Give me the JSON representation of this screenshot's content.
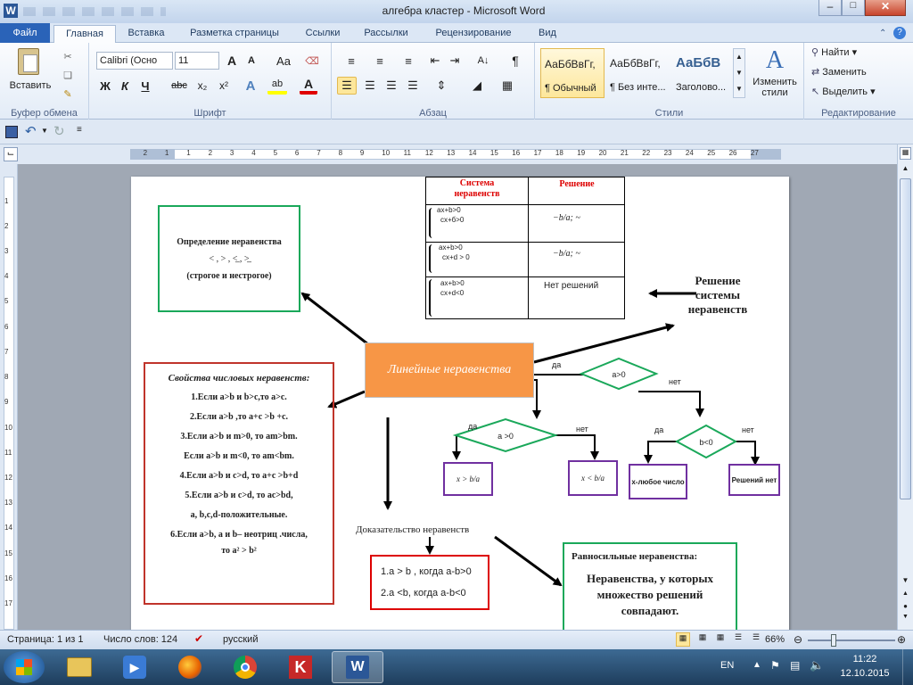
{
  "window": {
    "title": "алгебра кластер  -  Microsoft Word",
    "icon": "W"
  },
  "ribbon_tabs": [
    "Файл",
    "Главная",
    "Вставка",
    "Разметка страницы",
    "Ссылки",
    "Рассылки",
    "Рецензирование",
    "Вид"
  ],
  "clipboard": {
    "paste_label": "Вставить",
    "group_label": "Буфер обмена"
  },
  "font": {
    "name": "Calibri (Осно",
    "size": "11",
    "group_label": "Шрифт",
    "bold": "Ж",
    "italic": "К",
    "underline": "Ч",
    "strike": "abc",
    "sub": "x₂",
    "sup": "x²",
    "grow": "A",
    "shrink": "A",
    "case": "Aa"
  },
  "paragraph": {
    "group_label": "Абзац"
  },
  "styles": {
    "group_label": "Стили",
    "items": [
      {
        "preview": "АаБбВвГг,",
        "name": "¶ Обычный"
      },
      {
        "preview": "АаБбВвГг,",
        "name": "¶ Без инте..."
      },
      {
        "preview": "АаБбВ",
        "name": "Заголово..."
      }
    ],
    "change_label": "Изменить стили"
  },
  "editing": {
    "group_label": "Редактирование",
    "find": "Найти",
    "replace": "Заменить",
    "select": "Выделить"
  },
  "ruler_marks": [
    "2",
    "1",
    "1",
    "2",
    "3",
    "4",
    "5",
    "6",
    "7",
    "8",
    "9",
    "10",
    "11",
    "12",
    "13",
    "14",
    "15",
    "16",
    "17",
    "18",
    "19",
    "20",
    "21",
    "22",
    "23",
    "24",
    "25",
    "26",
    "27"
  ],
  "vruler_marks": [
    "1",
    "2",
    "3",
    "4",
    "5",
    "6",
    "7",
    "8",
    "9",
    "10",
    "11",
    "12",
    "13",
    "14",
    "15",
    "16",
    "17"
  ],
  "document": {
    "table": {
      "headers": [
        "Система неравенств",
        "Решение"
      ],
      "rows": [
        {
          "lines": [
            "ax+b>0",
            "cx+б>0"
          ],
          "solution": "−b/a;  ~"
        },
        {
          "lines": [
            "ax+b>0",
            "cx+d > 0"
          ],
          "solution": "−b/a;  ~"
        },
        {
          "lines": [
            "ax+b>0",
            "cx+d<0"
          ],
          "solution": "Нет решений"
        }
      ]
    },
    "definition": {
      "title": "Определение неравенства",
      "signs": "< , > ,  <̲ ,  >̲",
      "subtitle": "(строгое и нестрогое)"
    },
    "center": "Линейные неравенства",
    "system_solution": "Решение системы неравенств",
    "properties": {
      "title": "Свойства числовых неравенств:",
      "items": [
        "1.Если a>b и b>c,то a>c.",
        "2.Если  a>b ,то  a+c >b +c.",
        "3.Если a>b и m>0, то am>bm.",
        "Если  a>b и m<0, то am<bm.",
        "4.Если a>b и c>d, то a+c >b+d",
        "5.Если a>b и c>d, то ac>bd,",
        "a, b,c,d-положительные.",
        "6.Если a>b, a и b– неотриц .числа,",
        "то  a² > b²"
      ]
    },
    "flow": {
      "cond_a0": "a>0",
      "cond_a_gt0": "a >0",
      "cond_b0": "b<0",
      "yes": "да",
      "no": "нет",
      "x_gt": "x > b/a",
      "x_lt": "x < b/a",
      "any": "x-любое число",
      "none": "Решений нет"
    },
    "proof": {
      "title": "Доказательство неравенств",
      "items": [
        "1.a > b ,  когда a-b>0",
        "2.a <b, когда a-b<0"
      ]
    },
    "equiv": {
      "title": "Равносильные неравенства:",
      "body": "Неравенства, у   которых множество решений совпадают."
    }
  },
  "status": {
    "page": "Страница: 1 из 1",
    "words": "Число слов: 124",
    "lang": "русский",
    "zoom": "66%"
  },
  "taskbar": {
    "lang": "EN",
    "time": "11:22",
    "date": "12.10.2015"
  }
}
